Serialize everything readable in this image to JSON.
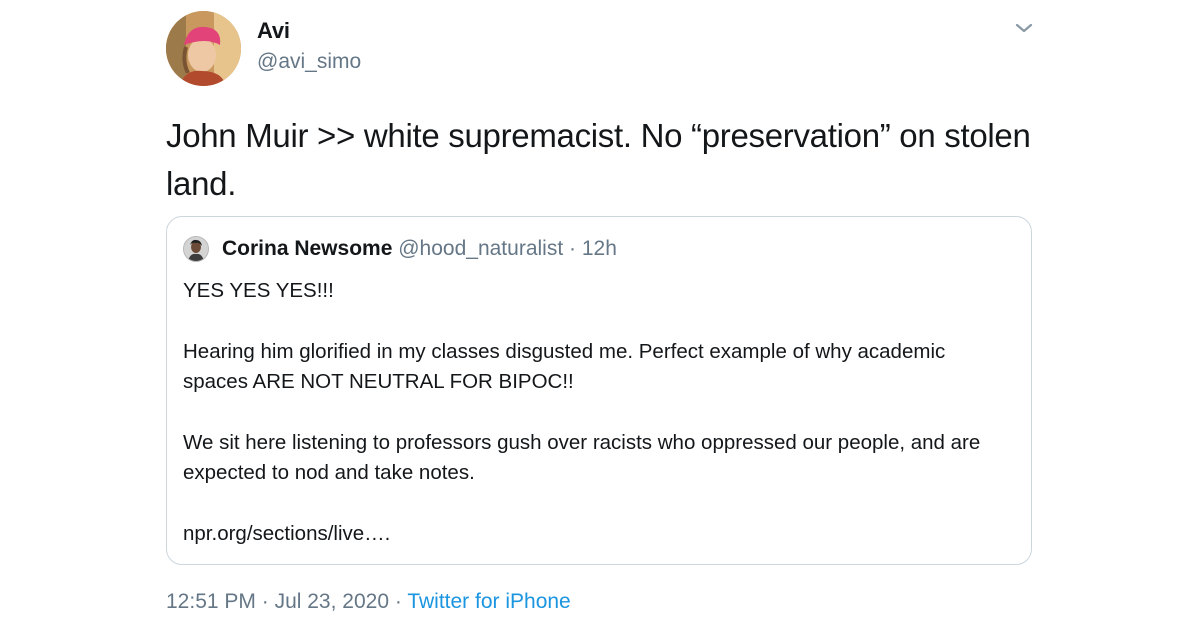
{
  "tweet": {
    "author_name": "Avi",
    "author_handle": "@avi_simo",
    "text": "John Muir >> white supremacist. No “preservation” on stolen land."
  },
  "quoted_tweet": {
    "author_name": "Corina Newsome",
    "author_handle": "@hood_naturalist",
    "separator": "·",
    "time": "12h",
    "paragraphs": [
      "YES YES YES!!!",
      "Hearing him glorified in my classes disgusted me. Perfect example of why academic spaces ARE NOT NEUTRAL FOR BIPOC!!",
      "We sit here listening to professors gush over racists who oppressed our people, and are expected to nod and take notes.",
      "npr.org/sections/live…."
    ]
  },
  "meta": {
    "time": "12:51 PM",
    "separator": "·",
    "date": "Jul 23, 2020",
    "source": "Twitter for iPhone"
  },
  "icons": {
    "menu": "chevron-down-icon"
  },
  "colors": {
    "text_primary": "#14171a",
    "text_secondary": "#657786",
    "link": "#1b95e0",
    "border": "#ccd6dd"
  }
}
